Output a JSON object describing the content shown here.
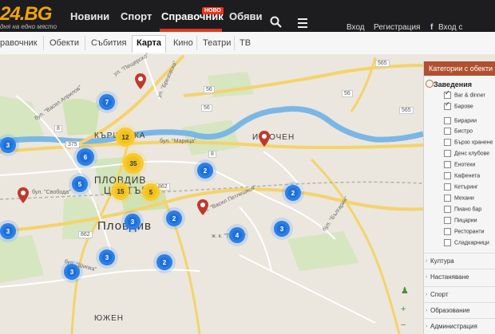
{
  "header": {
    "logo": "24.BG",
    "logo_tag": "дня на едно място",
    "nav": [
      {
        "label": "Новини"
      },
      {
        "label": "Спорт"
      },
      {
        "label": "Справочник",
        "badge": "НОВО"
      },
      {
        "label": "Обяви"
      }
    ],
    "login": "Вход",
    "register": "Регистрация",
    "facebook": "Вход с facebook"
  },
  "subnav": {
    "tabs": [
      {
        "label": "равочник"
      },
      {
        "label": "Обекти"
      },
      {
        "label": "Събития"
      },
      {
        "label": "Карта"
      },
      {
        "label": "Кино"
      },
      {
        "label": "Театри"
      },
      {
        "label": "ТВ"
      }
    ],
    "active": "Карта"
  },
  "map": {
    "places": [
      {
        "name": "КЪРШИЯКА"
      },
      {
        "name": "ИЗГОЧЕН"
      },
      {
        "name": "ПЛОВДИВ"
      },
      {
        "name": "ЦЕНТЪР"
      },
      {
        "name": "Пловдив"
      },
      {
        "name": "ЮЖЕН"
      }
    ],
    "road_labels": [
      "375",
      "56",
      "565",
      "56",
      "565",
      "8",
      "862",
      "862",
      "8",
      "56"
    ],
    "streets": [
      {
        "name": "ул. \"Пещерско\""
      },
      {
        "name": "бул. \"Марица\""
      },
      {
        "name": "бул. \"Васил Априлов\""
      },
      {
        "name": "ул. \"Брезовска\""
      },
      {
        "name": "бул. \"Свобода\""
      },
      {
        "name": "ул. \"Васил Петлешков\""
      },
      {
        "name": "ж. к. \"Тракия\""
      },
      {
        "name": "бул. \"Шипка\""
      },
      {
        "name": "бул. \"България\""
      }
    ],
    "clusters": [
      {
        "count": "7",
        "color": "blue"
      },
      {
        "count": "3",
        "color": "blue"
      },
      {
        "count": "6",
        "color": "blue"
      },
      {
        "count": "12",
        "color": "yellow"
      },
      {
        "count": "35",
        "color": "yellow"
      },
      {
        "count": "5",
        "color": "blue"
      },
      {
        "count": "15",
        "color": "yellow"
      },
      {
        "count": "5",
        "color": "yellow"
      },
      {
        "count": "2",
        "color": "blue"
      },
      {
        "count": "3",
        "color": "blue"
      },
      {
        "count": "2",
        "color": "blue"
      },
      {
        "count": "3",
        "color": "blue"
      },
      {
        "count": "3",
        "color": "blue"
      },
      {
        "count": "4",
        "color": "blue"
      },
      {
        "count": "3",
        "color": "blue"
      },
      {
        "count": "2",
        "color": "blue"
      },
      {
        "count": "2",
        "color": "blue"
      },
      {
        "count": "3",
        "color": "blue"
      }
    ],
    "pin_color": "#c0392b",
    "cluster_blue": "#1e6fd7",
    "cluster_yellow": "#f2c01f"
  },
  "panel": {
    "title": "Категории с обекти",
    "group": "Заведения",
    "items": [
      {
        "label": "Bar & dinner",
        "checked": true
      },
      {
        "label": "Барове",
        "checked": true
      },
      {
        "label": "Бирарии",
        "checked": false
      },
      {
        "label": "Бистро",
        "checked": false
      },
      {
        "label": "Бързо хранене",
        "checked": false
      },
      {
        "label": "Денс клубове",
        "checked": false
      },
      {
        "label": "Енотеки",
        "checked": false
      },
      {
        "label": "Кафенета",
        "checked": false
      },
      {
        "label": "Кетъринг",
        "checked": false
      },
      {
        "label": "Механи",
        "checked": false
      },
      {
        "label": "Пиано бар",
        "checked": false
      },
      {
        "label": "Пицарии",
        "checked": false
      },
      {
        "label": "Ресторанти",
        "checked": false
      },
      {
        "label": "Сладкарници",
        "checked": false
      }
    ],
    "sections": [
      {
        "label": "Култура"
      },
      {
        "label": "Настаняване"
      },
      {
        "label": "Спорт"
      },
      {
        "label": "Образование"
      },
      {
        "label": "Администрация"
      }
    ],
    "accent": "#b15030"
  }
}
